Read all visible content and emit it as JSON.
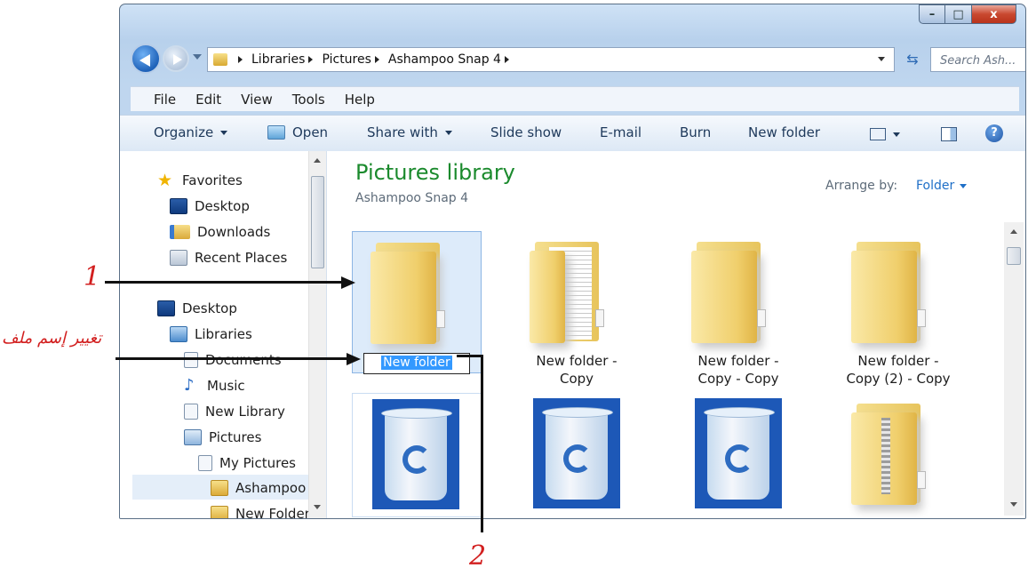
{
  "address": {
    "crumbs": [
      "Libraries",
      "Pictures",
      "Ashampoo Snap 4"
    ],
    "search_placeholder": "Search Ash..."
  },
  "caption_buttons": {
    "minimize": "–",
    "maximize": "□",
    "close": "x"
  },
  "menubar": [
    "File",
    "Edit",
    "View",
    "Tools",
    "Help"
  ],
  "toolbar": {
    "organize": "Organize",
    "open": "Open",
    "share_with": "Share with",
    "slide_show": "Slide show",
    "email": "E-mail",
    "burn": "Burn",
    "new_folder": "New folder",
    "help": "?"
  },
  "nav": {
    "favorites": "Favorites",
    "fav_desktop": "Desktop",
    "downloads": "Downloads",
    "recent_places": "Recent Places",
    "desktop": "Desktop",
    "libraries": "Libraries",
    "documents": "Documents",
    "music": "Music",
    "new_library": "New Library",
    "pictures": "Pictures",
    "my_pictures": "My Pictures",
    "ashampoo": "Ashampoo",
    "new_folder": "New Folder"
  },
  "content": {
    "title": "Pictures library",
    "subtitle": "Ashampoo Snap 4",
    "arrange_label": "Arrange by:",
    "arrange_value": "Folder",
    "items": [
      {
        "line1": "New folder",
        "line2": ""
      },
      {
        "line1": "New folder -",
        "line2": "Copy"
      },
      {
        "line1": "New folder -",
        "line2": "Copy - Copy"
      },
      {
        "line1": "New folder -",
        "line2": "Copy (2) - Copy"
      }
    ]
  },
  "annotations": {
    "label1": "1",
    "label2": "2",
    "arabic": "تغيير إسم ملف"
  },
  "colors": {
    "title_green": "#1b8a2d",
    "link_blue": "#1f6fc7",
    "annotation_red": "#d21f1f",
    "selection_blue": "#3399ff"
  }
}
